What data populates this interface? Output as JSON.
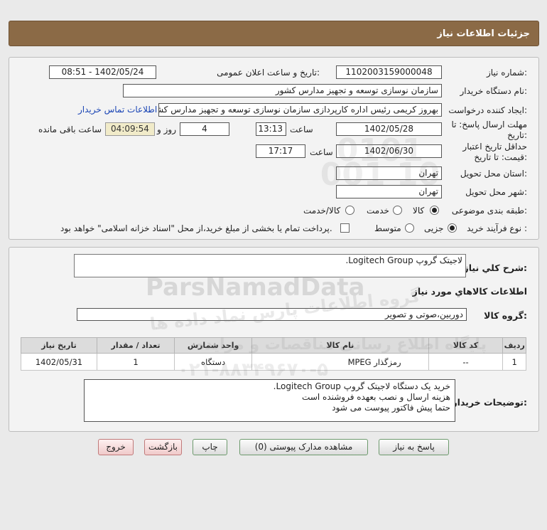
{
  "header": {
    "title": "جزئیات اطلاعات نیاز"
  },
  "form": {
    "need_number_label": "شماره نیاز:",
    "need_number": "1102003159000048",
    "announce_label": "تاریخ و ساعت اعلان عمومی:",
    "announce_value": "1402/05/24 - 08:51",
    "buyer_org_label": "نام دستگاه خریدار:",
    "buyer_org": "سازمان نوسازی  توسعه و تجهیز مدارس کشور",
    "creator_label": "ایجاد کننده درخواست:",
    "creator": "بهروز کریمی رئیس اداره کارپردازی سازمان نوسازی  توسعه و تجهیز مدارس کشور",
    "contact_link": "اطلاعات تماس خریدار",
    "deadline_label_1": "مهلت ارسال پاسخ: تا",
    "deadline_label_2": "تاریخ:",
    "deadline_date": "1402/05/28",
    "time_label": "ساعت",
    "deadline_time": "13:13",
    "days_value": "4",
    "days_label": "روز و",
    "remaining_time": "04:09:54",
    "remaining_label": "ساعت باقی مانده",
    "validity_label_1": "حداقل تاریخ اعتبار",
    "validity_label_2": "قیمت: تا تاریخ:",
    "validity_date": "1402/06/30",
    "validity_time": "17:17",
    "province_label": "استان محل تحویل:",
    "province": "تهران",
    "city_label": "شهر محل تحویل:",
    "city": "تهران",
    "category_label": "طبقه بندی موضوعی:",
    "category_options": [
      "کالا",
      "خدمت",
      "کالا/خدمت"
    ],
    "category_selected": "کالا",
    "process_label": "نوع فرآیند خرید :",
    "process_options": [
      "جزیی",
      "متوسط"
    ],
    "process_selected": "جزیی",
    "payment_note": "پرداخت تمام یا بخشی از مبلغ خرید،از محل \"اسناد خزانه اسلامی\" خواهد بود."
  },
  "summary": {
    "title_label": "شرح کلي نیاز:",
    "title_value": "لاجیتک گروپ Logitech Group.",
    "goods_info_label": "اطلاعات کالاهاي مورد نياز",
    "goods_group_label": "گروه کالا:",
    "goods_group_value": "دوربین،صوتی و تصویر"
  },
  "table": {
    "headers": [
      "ردیف",
      "کد کالا",
      "نام کالا",
      "واحد شمارش",
      "تعداد / مقدار",
      "تاریخ نیاز"
    ],
    "rows": [
      [
        "1",
        "--",
        "رمزگذار MPEG",
        "دستگاه",
        "1",
        "1402/05/31"
      ]
    ]
  },
  "buyer_notes": {
    "label": "توضیحات خریدار:",
    "lines": [
      "خرید یک دستگاه  لاجیتک گروپ Logitech Group.",
      "هزینه ارسال و نصب بعهده فروشنده است",
      "حتما پیش فاکتور پیوست می شود"
    ]
  },
  "buttons": {
    "reply": "پاسخ به نیاز",
    "view_docs": "مشاهده مدارک پیوستی (0)",
    "print": "چاپ",
    "back": "بازگشت",
    "exit": "خروج"
  },
  "watermark": {
    "brand": "ParsNamadData",
    "persian": "گروه اطلاعات پارس نماد داده ها",
    "line2": "پایگاه اطلاع رسانی مناقصات و مزایده",
    "phone": "۰۲۱-۸۸۳۴۹۶۷۰-۵",
    "code": "0101 001 10"
  }
}
